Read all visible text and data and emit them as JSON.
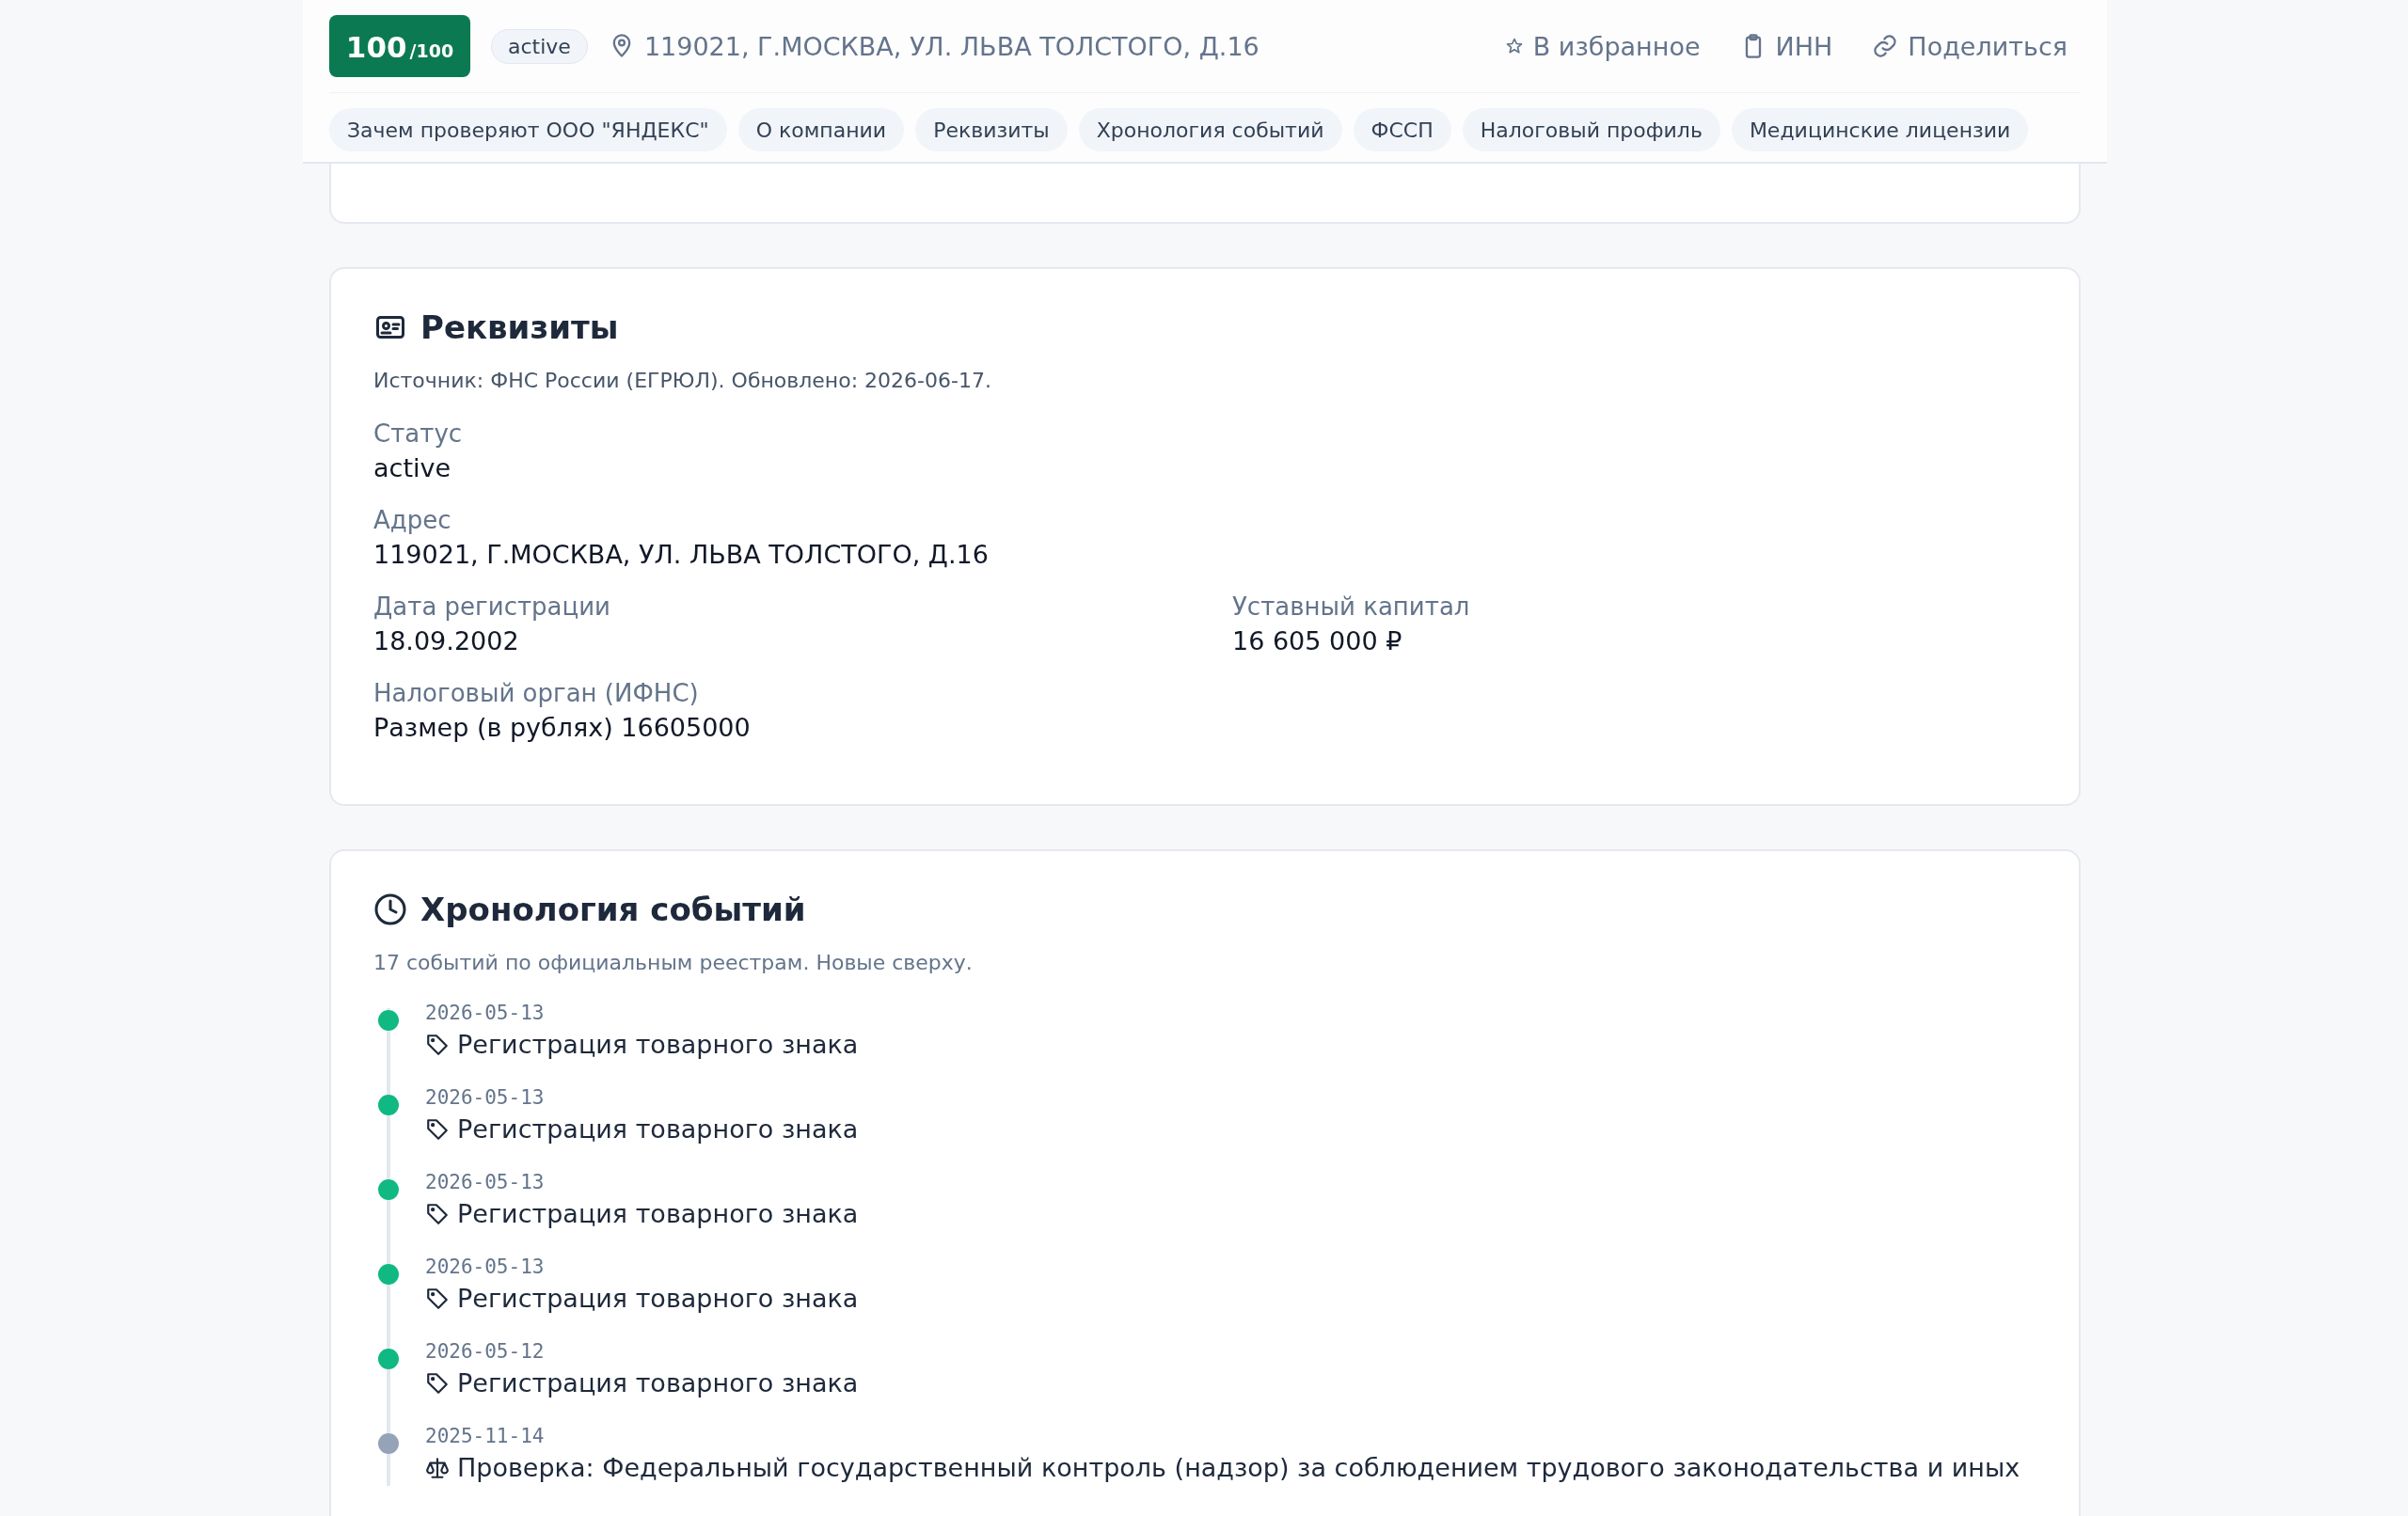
{
  "header": {
    "score": {
      "value": "100",
      "max": "/100"
    },
    "status": "active",
    "address": "119021, Г.МОСКВА, УЛ. ЛЬВА ТОЛСТОГО, Д.16",
    "actions": [
      {
        "kind": "star",
        "label": "В избранное"
      },
      {
        "kind": "clipboard",
        "label": "ИНН"
      },
      {
        "kind": "link",
        "label": "Поделиться"
      }
    ],
    "nav": [
      "Зачем проверяют ООО \"ЯНДЕКС\"",
      "О компании",
      "Реквизиты",
      "Хронология событий",
      "ФССП",
      "Налоговый профиль",
      "Медицинские лицензии"
    ]
  },
  "requisites": {
    "title": "Реквизиты",
    "source": "Источник: ФНС России (ЕГРЮЛ). Обновлено: 2026-06-17.",
    "rows": [
      [
        {
          "label": "Статус",
          "value": "active"
        }
      ],
      [
        {
          "label": "Адрес",
          "value": "119021, Г.МОСКВА, УЛ. ЛЬВА ТОЛСТОГО, Д.16"
        }
      ],
      [
        {
          "label": "Дата регистрации",
          "value": "18.09.2002"
        },
        {
          "label": "Уставный капитал",
          "value": "16 605 000 ₽"
        }
      ],
      [
        {
          "label": "Налоговый орган (ИФНС)",
          "value": "Размер (в рублях) 16605000"
        }
      ]
    ]
  },
  "timeline": {
    "title": "Хронология событий",
    "subtitle": "17 событий по официальным реестрам. Новые сверху.",
    "events": [
      {
        "date": "2026-05-13",
        "kind": "trademark",
        "color": "#10b981",
        "text": "Регистрация товарного знака"
      },
      {
        "date": "2026-05-13",
        "kind": "trademark",
        "color": "#10b981",
        "text": "Регистрация товарного знака"
      },
      {
        "date": "2026-05-13",
        "kind": "trademark",
        "color": "#10b981",
        "text": "Регистрация товарного знака"
      },
      {
        "date": "2026-05-13",
        "kind": "trademark",
        "color": "#10b981",
        "text": "Регистрация товарного знака"
      },
      {
        "date": "2026-05-12",
        "kind": "trademark",
        "color": "#10b981",
        "text": "Регистрация товарного знака"
      },
      {
        "date": "2025-11-14",
        "kind": "inspection",
        "color": "#94a3b8",
        "text": "Проверка: Федеральный государственный контроль (надзор) за соблюдением трудового законодательства и иных"
      }
    ]
  }
}
